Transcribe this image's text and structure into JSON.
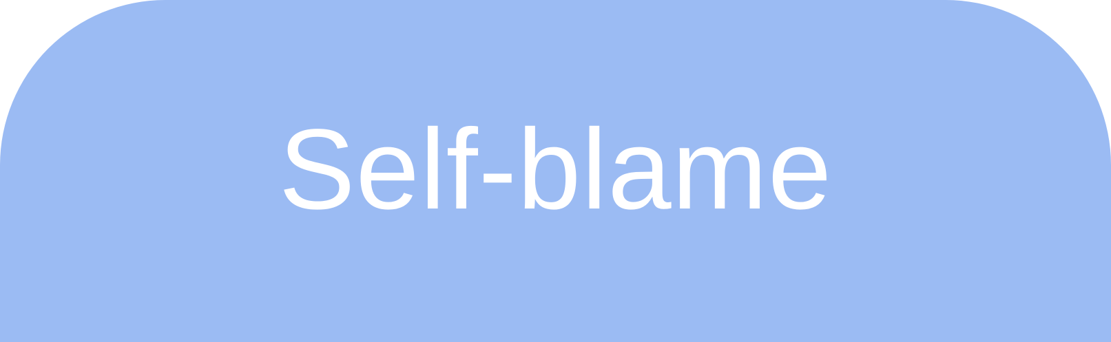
{
  "label": "Self-blame",
  "colors": {
    "background": "#9bbbf3",
    "text": "#ffffff"
  }
}
